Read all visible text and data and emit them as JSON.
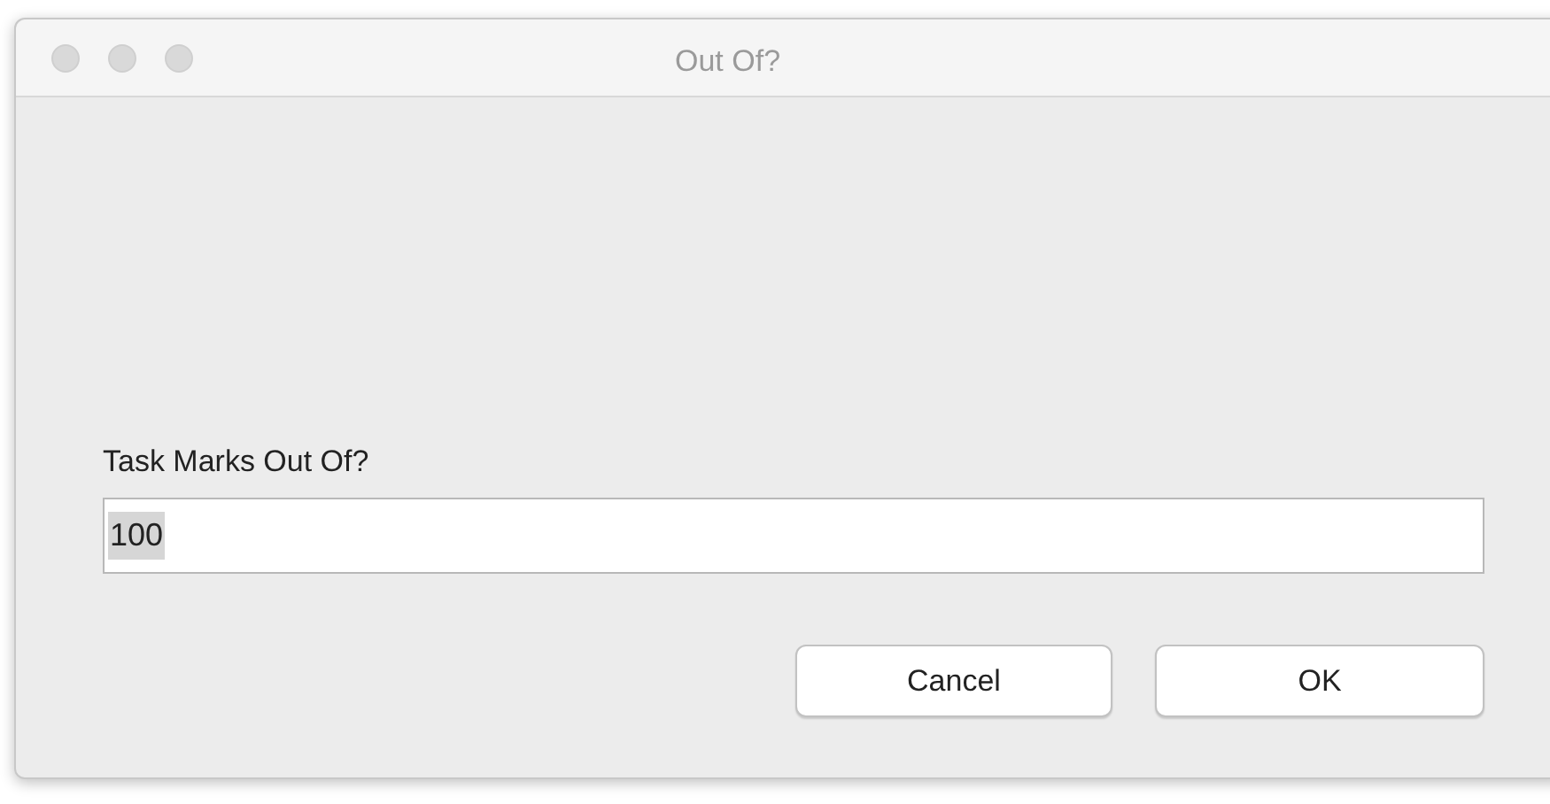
{
  "window": {
    "title": "Out Of?"
  },
  "prompt": {
    "label": "Task Marks Out Of?",
    "value": "100",
    "value_selected": true
  },
  "buttons": [
    {
      "label": "Cancel",
      "default": false
    },
    {
      "label": "OK",
      "default": false
    }
  ]
}
